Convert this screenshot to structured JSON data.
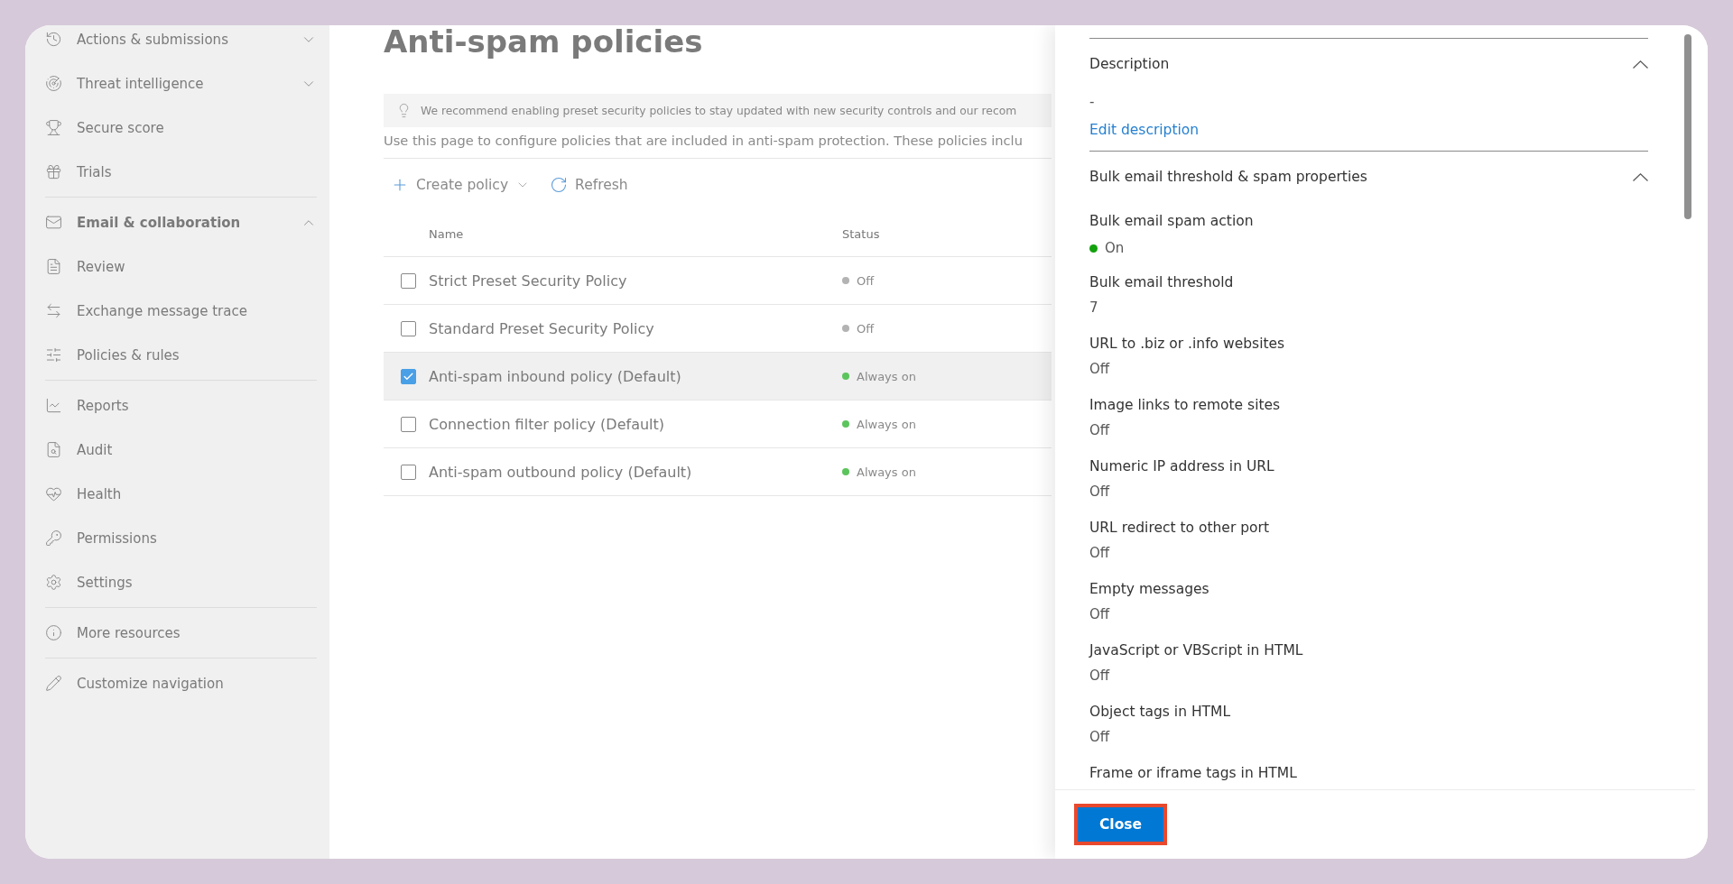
{
  "sidebar": {
    "groups": [
      {
        "items": [
          {
            "label": "Actions & submissions",
            "expanded": false
          },
          {
            "label": "Threat intelligence",
            "expanded": false
          },
          {
            "label": "Secure score"
          },
          {
            "label": "Trials"
          }
        ]
      },
      {
        "items": [
          {
            "label": "Email & collaboration",
            "expanded": true,
            "heading": true
          },
          {
            "label": "Review"
          },
          {
            "label": "Exchange message trace"
          },
          {
            "label": "Policies & rules"
          }
        ]
      },
      {
        "items": [
          {
            "label": "Reports"
          },
          {
            "label": "Audit"
          },
          {
            "label": "Health"
          },
          {
            "label": "Permissions"
          },
          {
            "label": "Settings"
          }
        ]
      },
      {
        "items": [
          {
            "label": "More resources"
          }
        ]
      },
      {
        "items": [
          {
            "label": "Customize navigation"
          }
        ]
      }
    ]
  },
  "main": {
    "title": "Anti-spam policies",
    "notice": "We recommend enabling preset security policies to stay updated with new security controls and our recom",
    "description": "Use this page to configure policies that are included in anti-spam protection. These policies inclu",
    "toolbar": [
      {
        "kind": "create",
        "label": "Create policy"
      },
      {
        "kind": "refresh",
        "label": "Refresh"
      }
    ],
    "table": {
      "columns": [
        "Name",
        "Status"
      ],
      "rows": [
        {
          "name": "Strict Preset Security Policy",
          "status": "Off",
          "color": "#b3b3b3",
          "selected": false
        },
        {
          "name": "Standard Preset Security Policy",
          "status": "Off",
          "color": "#b3b3b3",
          "selected": false
        },
        {
          "name": "Anti-spam inbound policy (Default)",
          "status": "Always on",
          "color": "#5cc45c",
          "selected": true
        },
        {
          "name": "Connection filter policy (Default)",
          "status": "Always on",
          "color": "#5cc45c",
          "selected": false
        },
        {
          "name": "Anti-spam outbound policy (Default)",
          "status": "Always on",
          "color": "#5cc45c",
          "selected": false
        }
      ]
    }
  },
  "panel": {
    "description": {
      "title": "Description",
      "expanded": true,
      "value": "-",
      "link": "Edit description"
    },
    "properties": {
      "title": "Bulk email threshold & spam properties",
      "expanded": true,
      "fields": [
        {
          "label": "Bulk email spam action",
          "value": "On",
          "kind": "status",
          "color": "#13a10e"
        },
        {
          "label": "Bulk email threshold",
          "value": "7",
          "kind": "text"
        },
        {
          "label": "URL to .biz or .info websites",
          "value": "Off",
          "kind": "text"
        },
        {
          "label": "Image links to remote sites",
          "value": "Off",
          "kind": "text"
        },
        {
          "label": "Numeric IP address in URL",
          "value": "Off",
          "kind": "text"
        },
        {
          "label": "URL redirect to other port",
          "value": "Off",
          "kind": "text"
        },
        {
          "label": "Empty messages",
          "value": "Off",
          "kind": "text"
        },
        {
          "label": "JavaScript or VBScript in HTML",
          "value": "Off",
          "kind": "text"
        },
        {
          "label": "Object tags in HTML",
          "value": "Off",
          "kind": "text"
        },
        {
          "label": "Frame or iframe tags in HTML",
          "kind": "text"
        }
      ]
    },
    "close_button": "Close"
  }
}
